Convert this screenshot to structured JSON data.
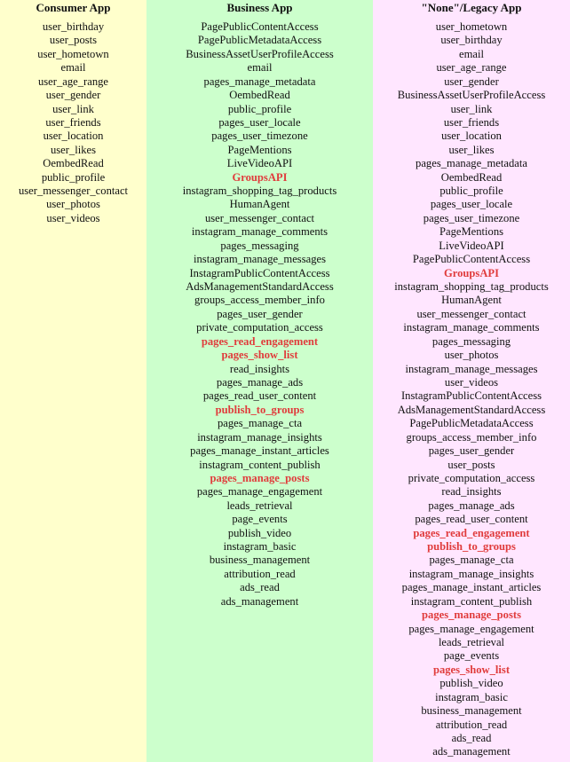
{
  "highlight_color": "#e03c3c",
  "columns": [
    {
      "header": "Consumer App",
      "bg": "#ffffcc",
      "items": [
        {
          "name": "user_birthday"
        },
        {
          "name": "user_posts"
        },
        {
          "name": "user_hometown"
        },
        {
          "name": "email"
        },
        {
          "name": "user_age_range"
        },
        {
          "name": "user_gender"
        },
        {
          "name": "user_link"
        },
        {
          "name": "user_friends"
        },
        {
          "name": "user_location"
        },
        {
          "name": "user_likes"
        },
        {
          "name": "OembedRead"
        },
        {
          "name": "public_profile"
        },
        {
          "name": "user_messenger_contact"
        },
        {
          "name": "user_photos"
        },
        {
          "name": "user_videos"
        }
      ]
    },
    {
      "header": "Business App",
      "bg": "#ccffcc",
      "items": [
        {
          "name": "PagePublicContentAccess"
        },
        {
          "name": "PagePublicMetadataAccess"
        },
        {
          "name": "BusinessAssetUserProfileAccess"
        },
        {
          "name": "email"
        },
        {
          "name": "pages_manage_metadata"
        },
        {
          "name": "OembedRead"
        },
        {
          "name": "public_profile"
        },
        {
          "name": "pages_user_locale"
        },
        {
          "name": "pages_user_timezone"
        },
        {
          "name": "PageMentions"
        },
        {
          "name": "LiveVideoAPI"
        },
        {
          "name": "GroupsAPI",
          "highlight": true
        },
        {
          "name": "instagram_shopping_tag_products"
        },
        {
          "name": "HumanAgent"
        },
        {
          "name": "user_messenger_contact"
        },
        {
          "name": "instagram_manage_comments"
        },
        {
          "name": "pages_messaging"
        },
        {
          "name": "instagram_manage_messages"
        },
        {
          "name": "InstagramPublicContentAccess"
        },
        {
          "name": "AdsManagementStandardAccess"
        },
        {
          "name": "groups_access_member_info"
        },
        {
          "name": "pages_user_gender"
        },
        {
          "name": "private_computation_access"
        },
        {
          "name": "pages_read_engagement",
          "highlight": true
        },
        {
          "name": "pages_show_list",
          "highlight": true
        },
        {
          "name": "read_insights"
        },
        {
          "name": "pages_manage_ads"
        },
        {
          "name": "pages_read_user_content"
        },
        {
          "name": "publish_to_groups",
          "highlight": true
        },
        {
          "name": "pages_manage_cta"
        },
        {
          "name": "instagram_manage_insights"
        },
        {
          "name": "pages_manage_instant_articles"
        },
        {
          "name": "instagram_content_publish"
        },
        {
          "name": "pages_manage_posts",
          "highlight": true
        },
        {
          "name": "pages_manage_engagement"
        },
        {
          "name": "leads_retrieval"
        },
        {
          "name": "page_events"
        },
        {
          "name": "publish_video"
        },
        {
          "name": "instagram_basic"
        },
        {
          "name": "business_management"
        },
        {
          "name": "attribution_read"
        },
        {
          "name": "ads_read"
        },
        {
          "name": "ads_management"
        }
      ]
    },
    {
      "header": "\"None\"/Legacy  App",
      "bg": "#ffe6ff",
      "items": [
        {
          "name": "user_hometown"
        },
        {
          "name": "user_birthday"
        },
        {
          "name": "email"
        },
        {
          "name": "user_age_range"
        },
        {
          "name": "user_gender"
        },
        {
          "name": "BusinessAssetUserProfileAccess"
        },
        {
          "name": "user_link"
        },
        {
          "name": "user_friends"
        },
        {
          "name": "user_location"
        },
        {
          "name": "user_likes"
        },
        {
          "name": "pages_manage_metadata"
        },
        {
          "name": "OembedRead"
        },
        {
          "name": "public_profile"
        },
        {
          "name": "pages_user_locale"
        },
        {
          "name": "pages_user_timezone"
        },
        {
          "name": "PageMentions"
        },
        {
          "name": "LiveVideoAPI"
        },
        {
          "name": "PagePublicContentAccess"
        },
        {
          "name": "GroupsAPI",
          "highlight": true
        },
        {
          "name": "instagram_shopping_tag_products"
        },
        {
          "name": "HumanAgent"
        },
        {
          "name": "user_messenger_contact"
        },
        {
          "name": "instagram_manage_comments"
        },
        {
          "name": "pages_messaging"
        },
        {
          "name": "user_photos"
        },
        {
          "name": "instagram_manage_messages"
        },
        {
          "name": "user_videos"
        },
        {
          "name": "InstagramPublicContentAccess"
        },
        {
          "name": "AdsManagementStandardAccess"
        },
        {
          "name": "PagePublicMetadataAccess"
        },
        {
          "name": "groups_access_member_info"
        },
        {
          "name": "pages_user_gender"
        },
        {
          "name": "user_posts"
        },
        {
          "name": "private_computation_access"
        },
        {
          "name": "read_insights"
        },
        {
          "name": "pages_manage_ads"
        },
        {
          "name": "pages_read_user_content"
        },
        {
          "name": "pages_read_engagement",
          "highlight": true
        },
        {
          "name": "publish_to_groups",
          "highlight": true
        },
        {
          "name": "pages_manage_cta"
        },
        {
          "name": "instagram_manage_insights"
        },
        {
          "name": "pages_manage_instant_articles"
        },
        {
          "name": "instagram_content_publish"
        },
        {
          "name": "pages_manage_posts",
          "highlight": true
        },
        {
          "name": "pages_manage_engagement"
        },
        {
          "name": "leads_retrieval"
        },
        {
          "name": "page_events"
        },
        {
          "name": "pages_show_list",
          "highlight": true
        },
        {
          "name": "publish_video"
        },
        {
          "name": "instagram_basic"
        },
        {
          "name": "business_management"
        },
        {
          "name": "attribution_read"
        },
        {
          "name": "ads_read"
        },
        {
          "name": "ads_management"
        }
      ]
    }
  ]
}
